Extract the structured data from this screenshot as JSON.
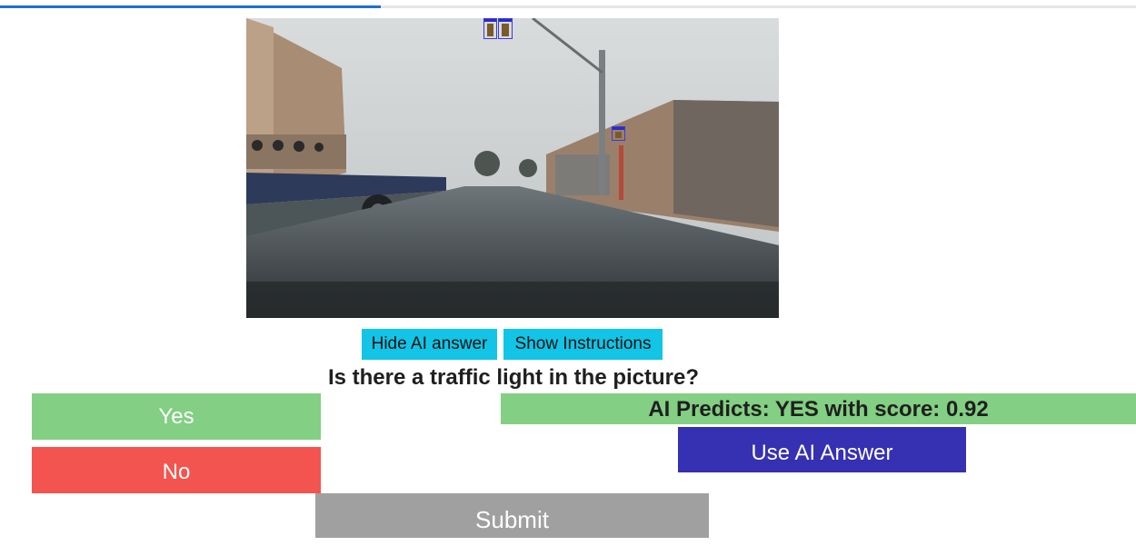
{
  "progress": {
    "fraction": 0.335,
    "fill_color": "#1e6fd9"
  },
  "image": {
    "icon": "street-scene-photo"
  },
  "controls": {
    "hide_ai_label": "Hide AI answer",
    "show_instructions_label": "Show Instructions"
  },
  "question": "Is there a traffic light in the picture?",
  "answers": {
    "yes_label": "Yes",
    "no_label": "No"
  },
  "ai": {
    "prediction_text": "AI Predicts: YES with score: 0.92",
    "use_button_label": "Use AI Answer"
  },
  "submit_label": "Submit",
  "colors": {
    "cyan": "#12c4e6",
    "green": "#83cf83",
    "red": "#f4544f",
    "indigo": "#3630b2",
    "gray": "#a0a0a0"
  }
}
